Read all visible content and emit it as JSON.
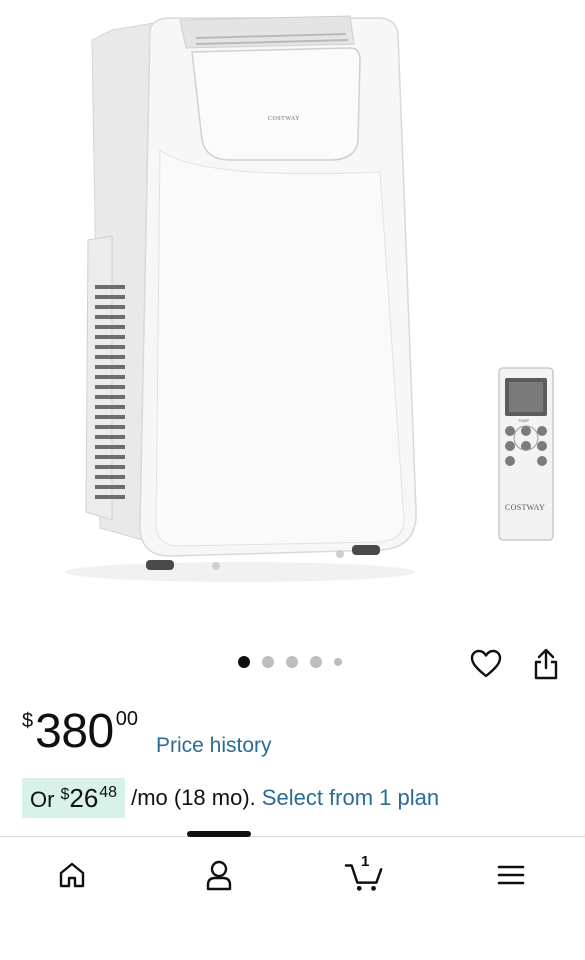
{
  "product": {
    "brand_logo_text": "COSTWAY",
    "remote_brand_text": "COSTWAY",
    "remote_temp_label": "TEMP",
    "image_alt": "Portable air conditioner with remote control",
    "carousel_dot_count": 5,
    "carousel_active_index": 0
  },
  "actions": {
    "wishlist_icon": "heart-icon",
    "share_icon": "share-icon"
  },
  "price": {
    "symbol": "$",
    "whole": "380",
    "fraction": "00",
    "history_link": "Price history"
  },
  "monthly": {
    "or_label": "Or",
    "symbol": "$",
    "whole": "26",
    "fraction": "48",
    "suffix": "/mo (18 mo).",
    "select_plan_link": "Select from 1 plan",
    "badge_color": "#d9f2e7"
  },
  "bottom_nav": {
    "home_icon": "home-icon",
    "account_icon": "account-icon",
    "cart_icon": "cart-icon",
    "cart_count": "1",
    "menu_icon": "menu-icon"
  },
  "colors": {
    "link": "#2a6c94",
    "text": "#0f1111"
  }
}
